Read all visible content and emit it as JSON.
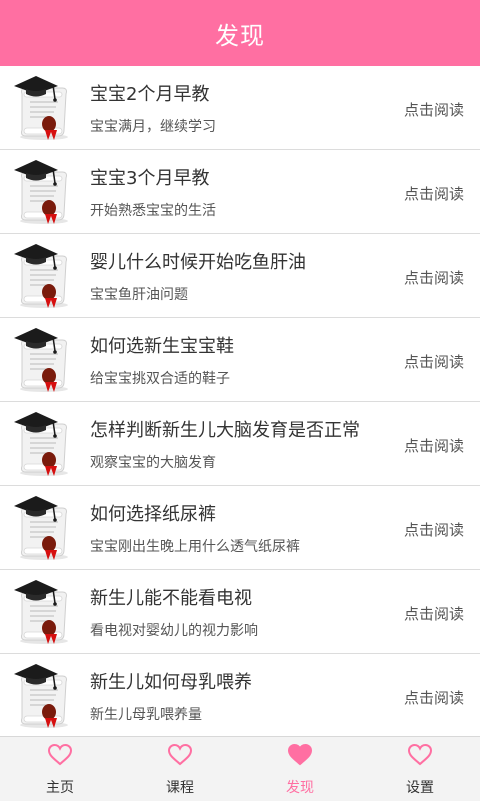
{
  "header": {
    "title": "发现"
  },
  "accent": "#ff6fa2",
  "items": [
    {
      "title": "宝宝2个月早教",
      "subtitle": "宝宝满月，继续学习",
      "action": "点击阅读",
      "icon": "diploma-scroll-icon"
    },
    {
      "title": "宝宝3个月早教",
      "subtitle": "开始熟悉宝宝的生活",
      "action": "点击阅读",
      "icon": "diploma-scroll-icon"
    },
    {
      "title": "婴儿什么时候开始吃鱼肝油",
      "subtitle": "宝宝鱼肝油问题",
      "action": "点击阅读",
      "icon": "diploma-scroll-icon"
    },
    {
      "title": "如何选新生宝宝鞋",
      "subtitle": "给宝宝挑双合适的鞋子",
      "action": "点击阅读",
      "icon": "diploma-scroll-icon"
    },
    {
      "title": "怎样判断新生儿大脑发育是否正常",
      "subtitle": "观察宝宝的大脑发育",
      "action": "点击阅读",
      "icon": "diploma-scroll-icon"
    },
    {
      "title": "如何选择纸尿裤",
      "subtitle": "宝宝刚出生晚上用什么透气纸尿裤",
      "action": "点击阅读",
      "icon": "diploma-scroll-icon"
    },
    {
      "title": "新生儿能不能看电视",
      "subtitle": "看电视对婴幼儿的视力影响",
      "action": "点击阅读",
      "icon": "diploma-scroll-icon"
    },
    {
      "title": "新生儿如何母乳喂养",
      "subtitle": "新生儿母乳喂养量",
      "action": "点击阅读",
      "icon": "diploma-scroll-icon"
    }
  ],
  "tabs": [
    {
      "label": "主页",
      "icon": "heart-outline-icon",
      "active": false
    },
    {
      "label": "课程",
      "icon": "heart-outline-icon",
      "active": false
    },
    {
      "label": "发现",
      "icon": "heart-filled-icon",
      "active": true
    },
    {
      "label": "设置",
      "icon": "heart-outline-icon",
      "active": false
    }
  ]
}
